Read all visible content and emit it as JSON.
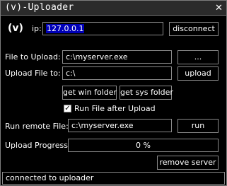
{
  "window": {
    "title": "(v)-Uploader",
    "close_glyph": "✕"
  },
  "logo": "(v)",
  "ip": {
    "label": "ip:",
    "value": "127.0.0.1"
  },
  "buttons": {
    "disconnect": "disconnect",
    "browse": "...",
    "upload": "upload",
    "get_win_folder": "get win folder",
    "get_sys_folder": "get sys folder",
    "run": "run",
    "remove_server": "remove server"
  },
  "file_to_upload": {
    "label": "File to Upload:",
    "value": "c:\\myserver.exe"
  },
  "upload_file_to": {
    "label": "Upload File to:",
    "value": "c:\\"
  },
  "run_after_upload": {
    "label": "Run File after Upload",
    "checked": true,
    "check_glyph": "✓"
  },
  "run_remote_file": {
    "label": "Run remote File:",
    "value": "c:\\myserver.exe"
  },
  "upload_progress": {
    "label": "Upload Progress:",
    "text": "0 %",
    "fraction": 0
  },
  "status": {
    "text": "connected to uploader"
  }
}
